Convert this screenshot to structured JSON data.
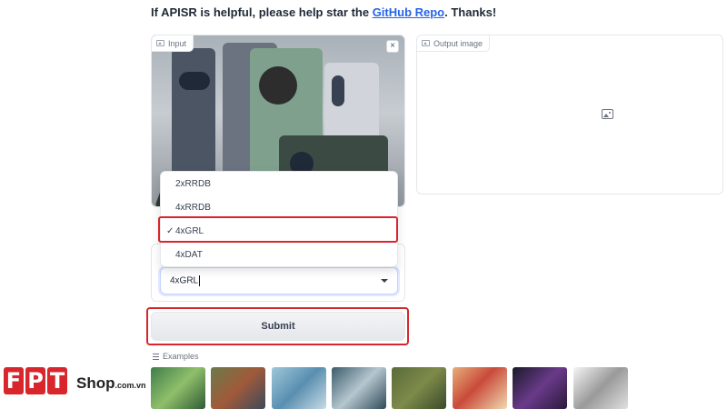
{
  "header": {
    "text_before": "If APISR is helpful, please help star the ",
    "link_text": "GitHub Repo",
    "text_after": ". Thanks!"
  },
  "input_panel": {
    "label": "Input",
    "close_symbol": "×",
    "icon": "image-icon"
  },
  "output_panel": {
    "label": "Output image",
    "placeholder_icon": "image-icon"
  },
  "model_dropdown": {
    "options": [
      "2xRRDB",
      "4xRRDB",
      "4xGRL",
      "4xDAT"
    ],
    "selected": "4xGRL",
    "check_mark": "✓",
    "value": "4xGRL"
  },
  "submit": {
    "label": "Submit"
  },
  "examples": {
    "label": "Examples",
    "count": 8
  },
  "watermark": {
    "letters": [
      "F",
      "P",
      "T"
    ],
    "shop": "Shop",
    "domain": ".com.vn"
  },
  "colors": {
    "accent_red": "#d9262c",
    "link_blue": "#2563eb",
    "submit_bg": "#e5e7eb"
  }
}
